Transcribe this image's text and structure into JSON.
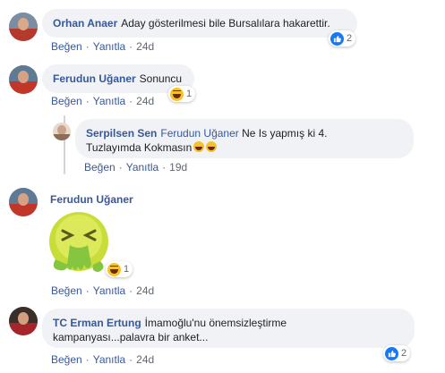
{
  "comments": [
    {
      "author": "Orhan Anaer",
      "text": "Aday gösterilmesi bile Bursalılara hakarettir.",
      "like_label": "Beğen",
      "reply_label": "Yanıtla",
      "time": "24d",
      "reactions": {
        "type": "like",
        "count": "2"
      }
    },
    {
      "author": "Ferudun Uğaner",
      "text": "Sonuncu",
      "like_label": "Beğen",
      "reply_label": "Yanıtla",
      "time": "24d",
      "reactions": {
        "type": "haha",
        "count": "1"
      },
      "reply": {
        "author": "Serpilsen Sen",
        "mention": "Ferudun Uğaner",
        "text_line1": "Ne Is yapmış ki 4.",
        "text_line2": "Tuzlayımda Kokmasın",
        "like_label": "Beğen",
        "reply_label": "Yanıtla",
        "time": "19d"
      }
    },
    {
      "author": "Ferudun Uğaner",
      "sticker": "vomiting-face-sticker",
      "like_label": "Beğen",
      "reply_label": "Yanıtla",
      "time": "24d",
      "reactions": {
        "type": "haha",
        "count": "1"
      }
    },
    {
      "author": "TC Erman Ertung",
      "text_line1": "İmamoğlu'nu önemsizleştirme",
      "text_line2": "kampanyası...palavra bir anket...",
      "like_label": "Beğen",
      "reply_label": "Yanıtla",
      "time": "24d",
      "reactions": {
        "type": "like",
        "count": "2"
      }
    }
  ],
  "colors": {
    "link": "#385898",
    "bubble": "#f0f2f5",
    "meta": "#606770",
    "like_blue": "#1877f2",
    "haha_yellow": "#f7c12a"
  }
}
